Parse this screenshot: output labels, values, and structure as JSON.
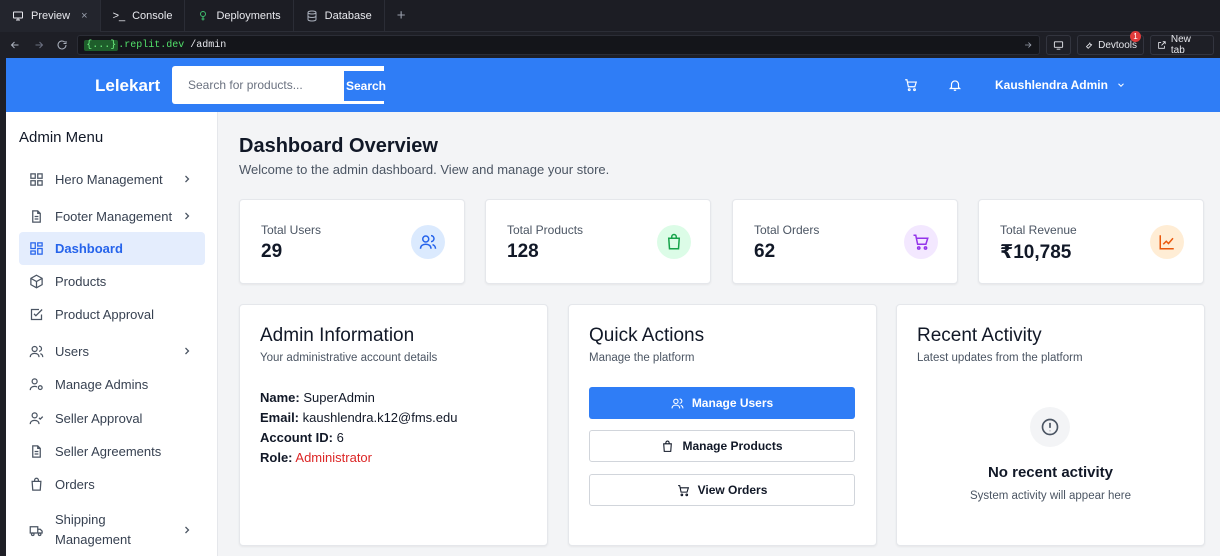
{
  "browser": {
    "tabs": [
      {
        "label": "Preview",
        "icon": "monitor-icon",
        "active": true
      },
      {
        "label": "Console",
        "icon": "terminal-icon"
      },
      {
        "label": "Deployments",
        "icon": "deploy-icon"
      },
      {
        "label": "Database",
        "icon": "database-icon"
      }
    ],
    "new_tab_symbol": "+",
    "host_braces": "{...}",
    "host": ".replit.dev",
    "path": "/admin",
    "devtools_label": "Devtools",
    "devtools_badge": "1",
    "newtab_label": "New tab"
  },
  "header": {
    "logo": "Lelekart",
    "search_placeholder": "Search for products...",
    "search_button": "Search",
    "user_name": "Kaushlendra Admin",
    "brand_color": "#2f7df6"
  },
  "sidebar": {
    "title": "Admin Menu",
    "items": [
      {
        "label": "Hero Management",
        "icon": "grid-icon",
        "chevron": true
      },
      {
        "label": "Footer Management",
        "icon": "file-icon",
        "chevron": true
      },
      {
        "label": "Dashboard",
        "icon": "dashboard-icon",
        "active": true
      },
      {
        "label": "Products",
        "icon": "package-icon"
      },
      {
        "label": "Product Approval",
        "icon": "check-square-icon"
      },
      {
        "label": "Users",
        "icon": "users-icon",
        "chevron": true
      },
      {
        "label": "Manage Admins",
        "icon": "user-cog-icon"
      },
      {
        "label": "Seller Approval",
        "icon": "user-check-icon"
      },
      {
        "label": "Seller Agreements",
        "icon": "file-text-icon"
      },
      {
        "label": "Orders",
        "icon": "shopping-bag-icon"
      },
      {
        "label": "Shipping",
        "label2": "Management",
        "icon": "truck-icon",
        "chevron": true
      }
    ]
  },
  "main": {
    "title": "Dashboard Overview",
    "subtitle": "Welcome to the admin dashboard. View and manage your store.",
    "stats": [
      {
        "label": "Total Users",
        "value": "29",
        "icon": "users-icon",
        "color": "#2563eb",
        "bg": "#dbeafe"
      },
      {
        "label": "Total Products",
        "value": "128",
        "icon": "shopping-bag-icon",
        "color": "#16a34a",
        "bg": "#dcfce7"
      },
      {
        "label": "Total Orders",
        "value": "62",
        "icon": "cart-icon",
        "color": "#9333ea",
        "bg": "#f3e8ff"
      },
      {
        "label": "Total Revenue",
        "value": "₹10,785",
        "icon": "trend-icon",
        "color": "#ea580c",
        "bg": "#ffedd5"
      }
    ],
    "admin_info": {
      "title": "Admin Information",
      "subtitle": "Your administrative account details",
      "name_label": "Name:",
      "name": "SuperAdmin",
      "email_label": "Email:",
      "email": "kaushlendra.k12@fms.edu",
      "id_label": "Account ID:",
      "id": "6",
      "role_label": "Role:",
      "role": "Administrator"
    },
    "quick_actions": {
      "title": "Quick Actions",
      "subtitle": "Manage the platform",
      "buttons": [
        "Manage Users",
        "Manage Products",
        "View Orders"
      ]
    },
    "recent_activity": {
      "title": "Recent Activity",
      "subtitle": "Latest updates from the platform",
      "empty_title": "No recent activity",
      "empty_sub": "System activity will appear here"
    }
  }
}
